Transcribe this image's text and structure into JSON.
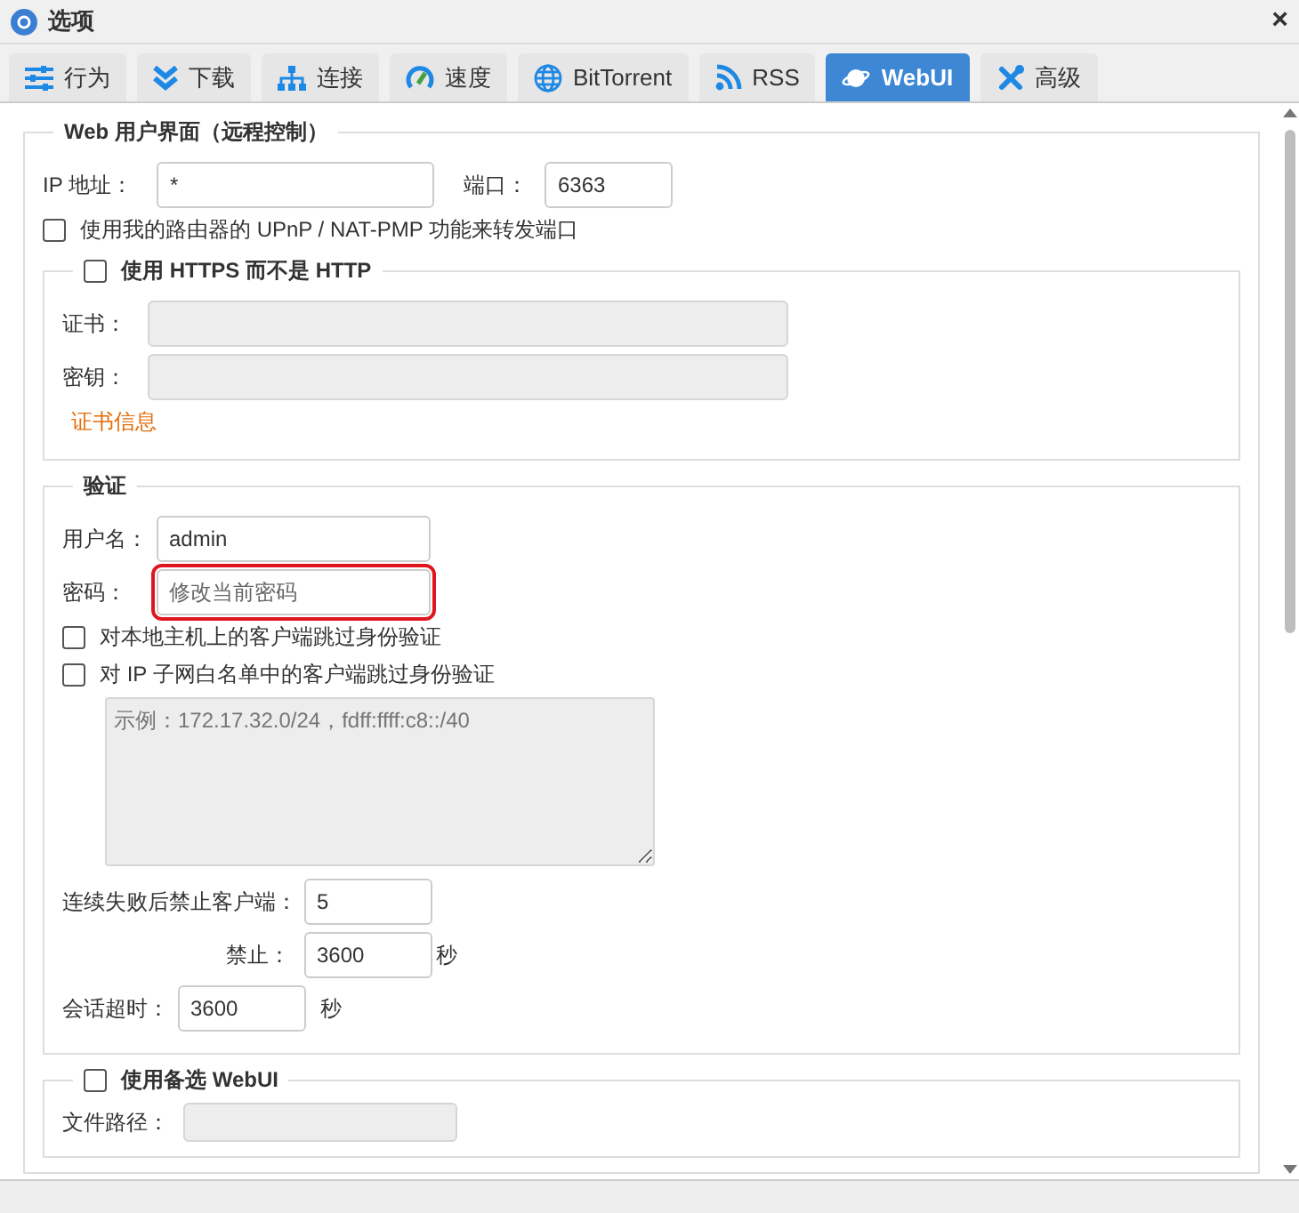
{
  "window": {
    "title": "选项",
    "close": "×"
  },
  "tabs": [
    {
      "label": "行为",
      "selected": false
    },
    {
      "label": "下载",
      "selected": false
    },
    {
      "label": "连接",
      "selected": false
    },
    {
      "label": "速度",
      "selected": false
    },
    {
      "label": "BitTorrent",
      "selected": false
    },
    {
      "label": "RSS",
      "selected": false
    },
    {
      "label": "WebUI",
      "selected": true
    },
    {
      "label": "高级",
      "selected": false
    }
  ],
  "web_ui": {
    "legend": "Web 用户界面（远程控制）",
    "ip_label": "IP 地址：",
    "ip_value": "*",
    "port_label": "端口：",
    "port_value": "6363",
    "upnp": {
      "label": "使用我的路由器的 UPnP / NAT-PMP 功能来转发端口",
      "checked": false
    },
    "https": {
      "legend": "使用 HTTPS 而不是 HTTP",
      "checked": false,
      "cert_label": "证书：",
      "key_label": "密钥：",
      "fields_disabled": true,
      "cert_info_link": "证书信息"
    },
    "auth": {
      "legend": "验证",
      "username_label": "用户名：",
      "username_value": "admin",
      "password_label": "密码：",
      "password_placeholder": "修改当前密码",
      "password_highlighted": true,
      "bypass_local": {
        "label": "对本地主机上的客户端跳过身份验证",
        "checked": false
      },
      "bypass_whitelist": {
        "label": "对 IP 子网白名单中的客户端跳过身份验证",
        "checked": false
      },
      "whitelist_placeholder": "示例：172.17.32.0/24，fdff:ffff:c8::/40",
      "whitelist_disabled": true,
      "ban_after_label": "连续失败后禁止客户端：",
      "ban_after_value": "5",
      "ban_label": "禁止：",
      "ban_value": "3600",
      "ban_unit": "秒",
      "session_timeout_label": "会话超时：",
      "session_timeout_value": "3600",
      "session_timeout_unit": "秒"
    }
  },
  "alt_webui": {
    "legend": "使用备选 WebUI",
    "checked": false,
    "path_label": "文件路径：",
    "path_disabled": true
  }
}
